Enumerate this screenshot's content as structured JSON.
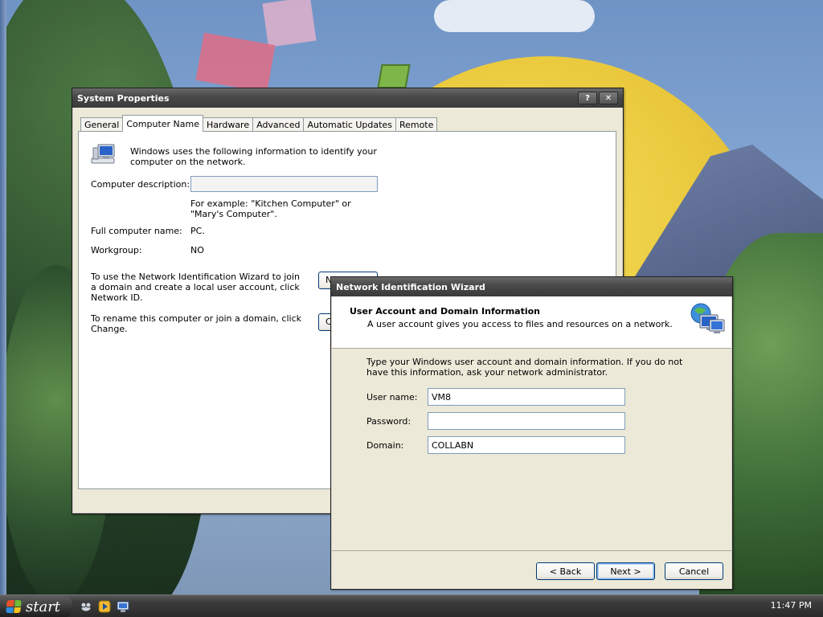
{
  "system_properties": {
    "title": "System Properties",
    "help_button": "?",
    "close_button": "✕",
    "tabs": [
      {
        "label": "General",
        "active": false
      },
      {
        "label": "Computer Name",
        "active": true
      },
      {
        "label": "Hardware",
        "active": false
      },
      {
        "label": "Advanced",
        "active": false
      },
      {
        "label": "Automatic Updates",
        "active": false
      },
      {
        "label": "Remote",
        "active": false
      }
    ],
    "intro_text": "Windows uses the following information to identify your computer on the network.",
    "computer_description_label": "Computer description:",
    "computer_description_value": "",
    "example_text": "For example: \"Kitchen Computer\" or \"Mary's Computer\".",
    "full_name_label": "Full computer name:",
    "full_name_value": "PC.",
    "workgroup_label": "Workgroup:",
    "workgroup_value": "NO",
    "network_id_text": "To use the Network Identification Wizard to join a domain and create a local user account, click Network ID.",
    "network_id_button": "Network ID...",
    "rename_text": "To rename this computer or join a domain, click Change.",
    "change_button": "Change..."
  },
  "wizard": {
    "title": "Network Identification Wizard",
    "header_title": "User Account and Domain Information",
    "header_subtitle": "A user account gives you access to files and resources on a network.",
    "intro": "Type your Windows user account and domain information. If you do not have this information, ask your network administrator.",
    "fields": {
      "username_label": "User name:",
      "username_value": "VM8",
      "password_label": "Password:",
      "password_value": "",
      "domain_label": "Domain:",
      "domain_value": "COLLABN"
    },
    "buttons": {
      "back": "< Back",
      "next": "Next >",
      "cancel": "Cancel"
    }
  },
  "taskbar": {
    "start_label": "start",
    "quick_launch": [
      "outlook-express-icon",
      "media-player-icon",
      "show-desktop-icon"
    ],
    "clock": "11:47 PM"
  },
  "colors": {
    "titlebar": "#4a4a4a",
    "dialog_face": "#ece9d8",
    "taskbar": "#3c3c3c"
  }
}
